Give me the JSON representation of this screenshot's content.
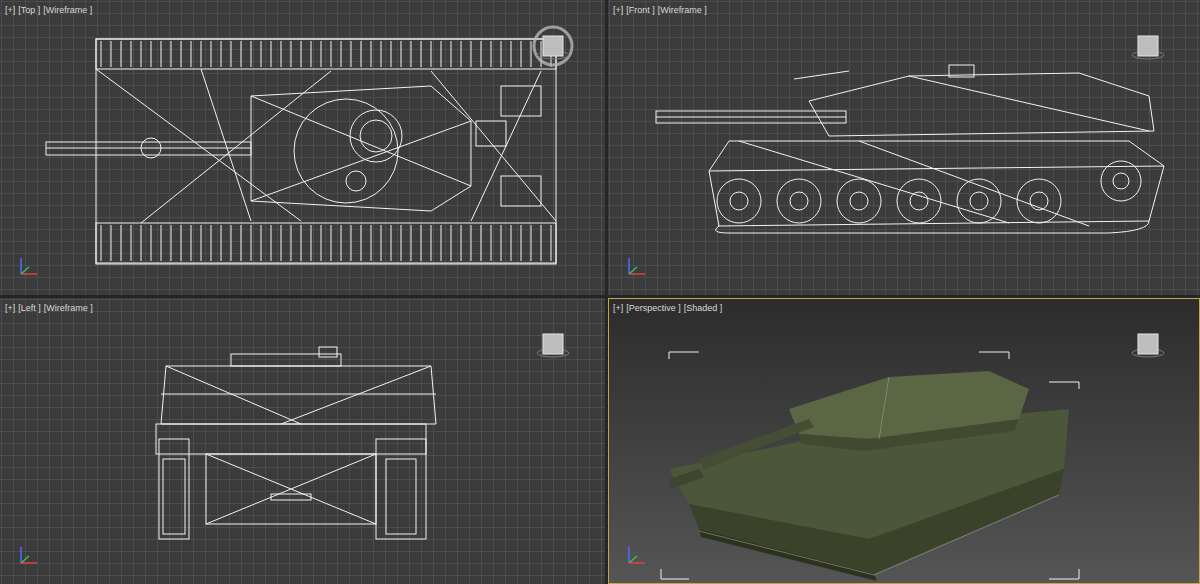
{
  "viewports": [
    {
      "labels": [
        "[+]",
        "[Top ]",
        "[Wireframe ]"
      ],
      "kind": "top",
      "selected": false
    },
    {
      "labels": [
        "[+]",
        "[Front ]",
        "[Wireframe ]"
      ],
      "kind": "front",
      "selected": false
    },
    {
      "labels": [
        "[+]",
        "[Left ]",
        "[Wireframe ]"
      ],
      "kind": "left",
      "selected": false
    },
    {
      "labels": [
        "[+]",
        "[Perspective ]",
        "[Shaded ]"
      ],
      "kind": "perspective",
      "selected": true
    }
  ]
}
